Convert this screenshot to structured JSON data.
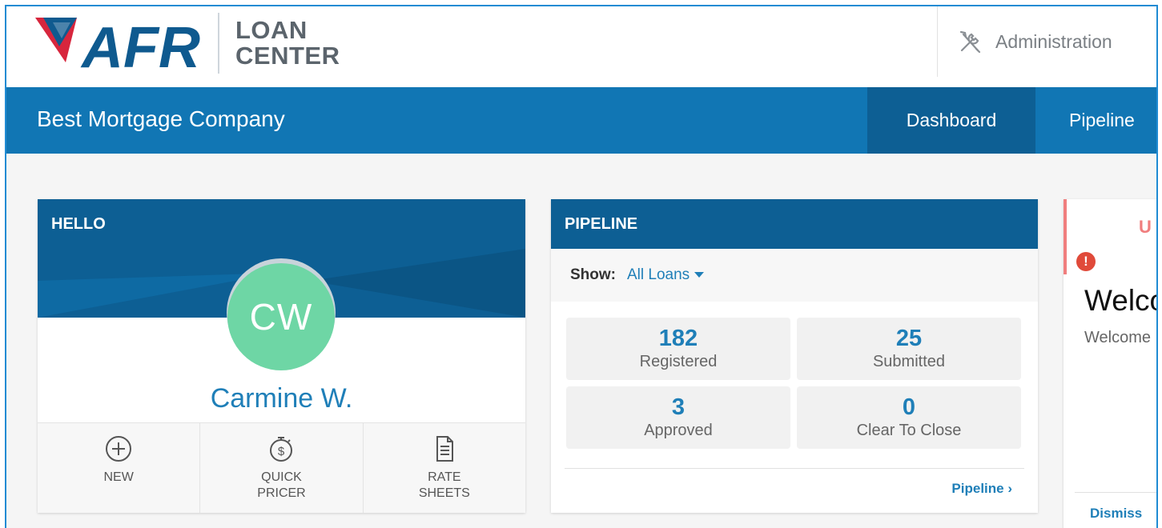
{
  "header": {
    "logo_text": "AFR",
    "product_line1": "LOAN",
    "product_line2": "CENTER",
    "admin_label": "Administration",
    "admin_icon": "tools-icon"
  },
  "nav": {
    "company": "Best Mortgage Company",
    "tabs": [
      {
        "label": "Dashboard",
        "active": true
      },
      {
        "label": "Pipeline",
        "active": false
      }
    ]
  },
  "hello_card": {
    "title": "HELLO",
    "initials": "CW",
    "name": "Carmine W.",
    "actions": [
      {
        "label1": "NEW",
        "label2": "",
        "icon": "plus-circle-icon"
      },
      {
        "label1": "QUICK",
        "label2": "PRICER",
        "icon": "stopwatch-dollar-icon"
      },
      {
        "label1": "RATE",
        "label2": "SHEETS",
        "icon": "document-icon"
      }
    ]
  },
  "pipeline_card": {
    "title": "PIPELINE",
    "show_label": "Show:",
    "show_value": "All Loans",
    "stats": [
      {
        "value": "182",
        "label": "Registered"
      },
      {
        "value": "25",
        "label": "Submitted"
      },
      {
        "value": "3",
        "label": "Approved"
      },
      {
        "value": "0",
        "label": "Clear To Close"
      }
    ],
    "link": "Pipeline ›"
  },
  "notice_card": {
    "heading_fragment": "U",
    "title": "Welco",
    "body": "Welcome",
    "dismiss": "Dismiss"
  },
  "colors": {
    "nav_blue": "#1176b4",
    "dark_blue": "#0d5f94",
    "accent": "#1f7fb8",
    "avatar": "#6ed6a5",
    "alert": "#f07e7e"
  }
}
